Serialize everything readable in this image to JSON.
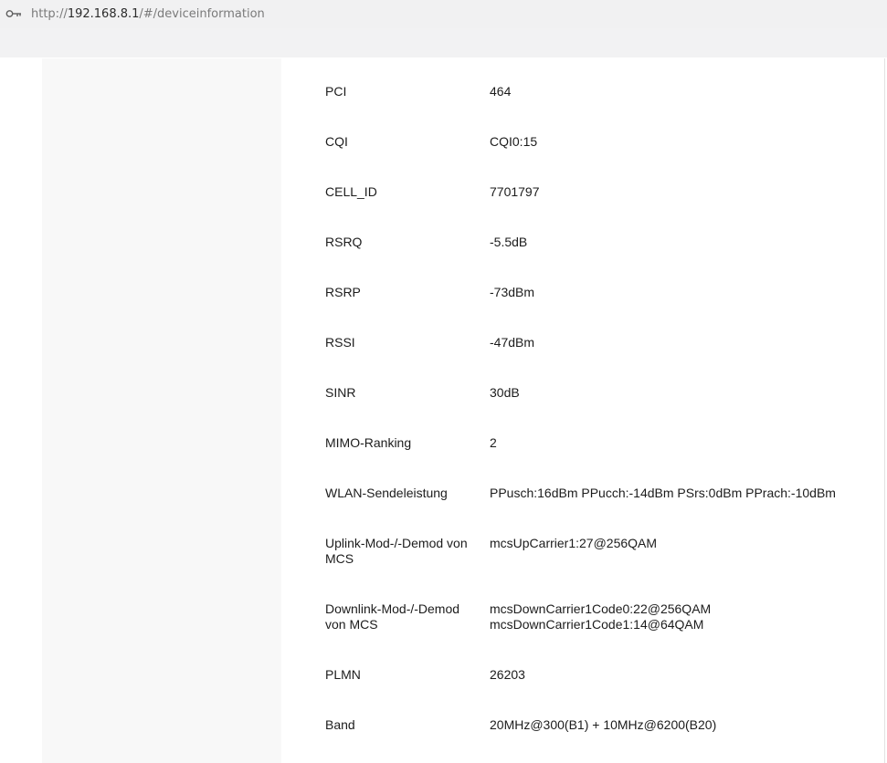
{
  "browser": {
    "url_prefix": "http://",
    "url_host": "192.168.8.1",
    "url_path": "/#/deviceinformation",
    "icon": "key-icon"
  },
  "info": [
    {
      "label": "PCI",
      "value": "464"
    },
    {
      "label": "CQI",
      "value": "CQI0:15"
    },
    {
      "label": "CELL_ID",
      "value": "7701797"
    },
    {
      "label": "RSRQ",
      "value": "-5.5dB"
    },
    {
      "label": "RSRP",
      "value": "-73dBm"
    },
    {
      "label": "RSSI",
      "value": "-47dBm"
    },
    {
      "label": "SINR",
      "value": "30dB"
    },
    {
      "label": "MIMO-Ranking",
      "value": "2"
    },
    {
      "label": "WLAN-Sendeleistung",
      "value": "PPusch:16dBm PPucch:-14dBm PSrs:0dBm PPrach:-10dBm"
    },
    {
      "label_line1": "Uplink-Mod-/-Demod von",
      "label_line2": "MCS",
      "value": "mcsUpCarrier1:27@256QAM"
    },
    {
      "label_line1": "Downlink-Mod-/-Demod",
      "label_line2": "von MCS",
      "value_line1": "mcsDownCarrier1Code0:22@256QAM",
      "value_line2": "mcsDownCarrier1Code1:14@64QAM"
    },
    {
      "label": "PLMN",
      "value": "26203"
    },
    {
      "label": "Band",
      "value": "20MHz@300(B1) + 10MHz@6200(B20)"
    }
  ]
}
